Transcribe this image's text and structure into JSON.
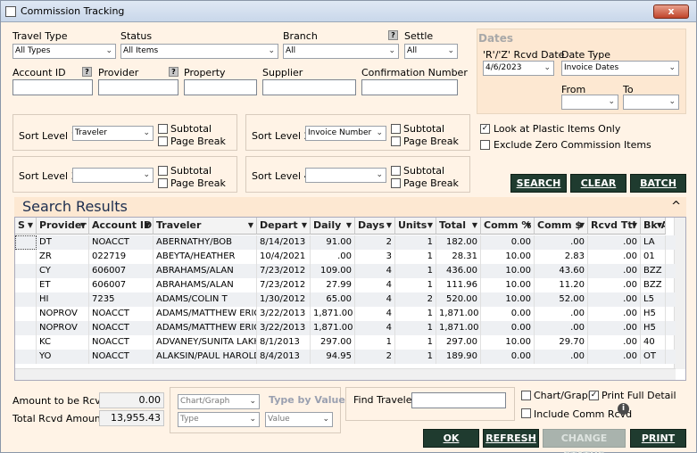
{
  "window": {
    "title": "Commission Tracking",
    "close_label": "x"
  },
  "filters": {
    "travel_type_label": "Travel Type",
    "travel_type_value": "All Types",
    "status_label": "Status",
    "status_value": "All Items",
    "branch_label": "Branch",
    "branch_value": "All",
    "settle_label": "Settle",
    "settle_value": "All",
    "account_id_label": "Account ID",
    "provider_label": "Provider",
    "property_label": "Property",
    "supplier_label": "Supplier",
    "confirmation_label": "Confirmation Number",
    "help_glyph": "?"
  },
  "dates": {
    "title": "Dates",
    "rcvd_label": "'R'/'Z' Rcvd Date",
    "rcvd_value": "4/6/2023",
    "date_type_label": "Date Type",
    "date_type_value": "Invoice Dates",
    "from_label": "From",
    "to_label": "To"
  },
  "sort": {
    "level1_label": "Sort Level 1",
    "level1_value": "Traveler",
    "level2_label": "Sort Level 2",
    "level2_value": "Invoice Number",
    "level3_label": "Sort Level 3",
    "level4_label": "Sort Level 4",
    "subtotal_label": "Subtotal",
    "pagebreak_label": "Page Break"
  },
  "options": {
    "plastic_label": "Look at Plastic Items Only",
    "plastic_checked": "✓",
    "zero_label": "Exclude Zero Commission Items"
  },
  "actions": {
    "search": "SEARCH",
    "clear": "CLEAR",
    "batch": "BATCH"
  },
  "results": {
    "title": "Search Results",
    "collapse_glyph": "^",
    "columns": [
      "S",
      "Provider",
      "Account ID",
      "Traveler",
      "Depart",
      "Daily",
      "Days",
      "Units",
      "Total",
      "Comm %",
      "Comm $",
      "Rcvd Ttl",
      "Bk A"
    ],
    "rows": [
      [
        "",
        "DT",
        "NOACCT",
        "ABERNATHY/BOB",
        "8/14/2013",
        "91.00",
        "2",
        "1",
        "182.00",
        "0.00",
        ".00",
        ".00",
        "LA"
      ],
      [
        "",
        "ZR",
        "022719",
        "ABEYTA/HEATHER",
        "10/4/2021",
        ".00",
        "3",
        "1",
        "28.31",
        "10.00",
        "2.83",
        ".00",
        "01"
      ],
      [
        "",
        "CY",
        "606007",
        "ABRAHAMS/ALAN",
        "7/23/2012",
        "109.00",
        "4",
        "1",
        "436.00",
        "10.00",
        "43.60",
        ".00",
        "BZZ"
      ],
      [
        "",
        "ET",
        "606007",
        "ABRAHAMS/ALAN",
        "7/23/2012",
        "27.99",
        "4",
        "1",
        "111.96",
        "10.00",
        "11.20",
        ".00",
        "BZZ"
      ],
      [
        "",
        "HI",
        "7235",
        "ADAMS/COLIN T",
        "1/30/2012",
        "65.00",
        "4",
        "2",
        "520.00",
        "10.00",
        "52.00",
        ".00",
        "L5"
      ],
      [
        "",
        "NOPROV",
        "NOACCT",
        "ADAMS/MATTHEW ERIC",
        "3/22/2013",
        "1,871.00",
        "4",
        "1",
        "1,871.00",
        "0.00",
        ".00",
        ".00",
        "H5"
      ],
      [
        "",
        "NOPROV",
        "NOACCT",
        "ADAMS/MATTHEW ERIC",
        "3/22/2013",
        "1,871.00",
        "4",
        "1",
        "1,871.00",
        "0.00",
        ".00",
        ".00",
        "H5"
      ],
      [
        "",
        "KC",
        "NOACCT",
        "ADVANEY/SUNITA LAKH",
        "8/1/2013",
        "297.00",
        "1",
        "1",
        "297.00",
        "10.00",
        "29.70",
        ".00",
        "40"
      ],
      [
        "",
        "YO",
        "NOACCT",
        "ALAKSIN/PAUL HAROLD",
        "8/4/2013",
        "94.95",
        "2",
        "1",
        "189.90",
        "0.00",
        ".00",
        ".00",
        "OT"
      ]
    ]
  },
  "footer": {
    "amount_rcvd_label": "Amount to be Rcvd",
    "amount_rcvd_value": "0.00",
    "total_rcvd_label": "Total Rcvd Amount",
    "total_rcvd_value": "13,955.43",
    "chart_select": "Chart/Graph",
    "type_by_value_label": "Type by Value",
    "type_select": "Type",
    "value_select": "Value",
    "find_traveler_label": "Find Traveler",
    "chart_cb_label": "Chart/Graph",
    "print_full_label": "Print Full Detail",
    "print_full_checked": "✓",
    "include_comm_label": "Include Comm Rcvd",
    "info_glyph": "i"
  },
  "bottom_buttons": {
    "ok": "OK",
    "refresh": "REFRESH",
    "change_status": "CHANGE STATUS",
    "print": "PRINT"
  }
}
